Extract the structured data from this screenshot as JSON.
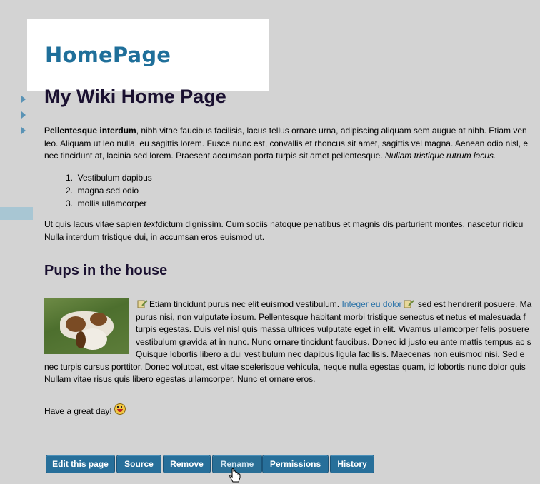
{
  "header": {
    "site_title": "HomePage"
  },
  "page": {
    "title": "My Wiki Home Page",
    "intro": {
      "bold_lead": "Pellentesque interdum",
      "line1_rest": ", nibh vitae faucibus facilisis, lacus tellus ornare urna, adipiscing aliquam sem augue at nibh. Etiam ven",
      "line2": "leo. Aliquam ut leo nulla, eu sagittis lorem. Fusce nunc est, convallis et rhoncus sit amet, sagittis vel magna. Aenean odio nisl, e",
      "line3_start": "nec tincidunt at, lacinia sed lorem. Praesent accumsan porta turpis sit amet pellentesque. ",
      "line3_italic": "Nullam tristique rutrum lacus."
    },
    "list": [
      {
        "num": "1.",
        "text": "Vestibulum dapibus"
      },
      {
        "num": "2.",
        "text": "magna sed odio"
      },
      {
        "num": "3.",
        "text": "mollis ullamcorper"
      }
    ],
    "para2": {
      "line1_start": "Ut quis lacus vitae sapien ",
      "line1_italic": "text",
      "line1_rest": "dictum dignissim. Cum sociis natoque penatibus et magnis dis parturient montes, nascetur ridicu",
      "line2": "Nulla interdum tristique dui, in accumsan eros euismod ut."
    },
    "section_title": "Pups in the house",
    "pups": {
      "line1_start": "Etiam tincidunt purus nec elit euismod vestibulum. ",
      "line1_link": "Integer eu dolor",
      "line1_rest": " sed est hendrerit posuere. Ma",
      "line2": "purus nisi, non vulputate ipsum. Pellentesque habitant morbi tristique senectus et netus et malesuada f",
      "line3": "turpis egestas. Duis vel nisl quis massa ultrices vulputate eget in elit. Vivamus ullamcorper felis posuere",
      "line4": "vestibulum gravida at in nunc. Nunc ornare tincidunt faucibus. Donec id justo eu ante mattis tempus ac s",
      "line5": "Quisque lobortis libero a dui vestibulum nec dapibus ligula facilisis. Maecenas non euismod nisi. Sed e",
      "line6": "nec turpis cursus porttitor. Donec volutpat, est vitae scelerisque vehicula, neque nulla egestas quam, id lobortis nunc dolor quis",
      "line7": "Nullam vitae risus quis libero egestas ullamcorper. Nunc et ornare eros."
    },
    "closing": "Have a great day!"
  },
  "toolbar": {
    "edit": "Edit this page",
    "source": "Source",
    "remove": "Remove",
    "rename": "Rename",
    "permissions": "Permissions",
    "history": "History"
  },
  "colors": {
    "accent": "#276f9a",
    "background": "#d3d3d3",
    "link": "#2b73a8"
  }
}
